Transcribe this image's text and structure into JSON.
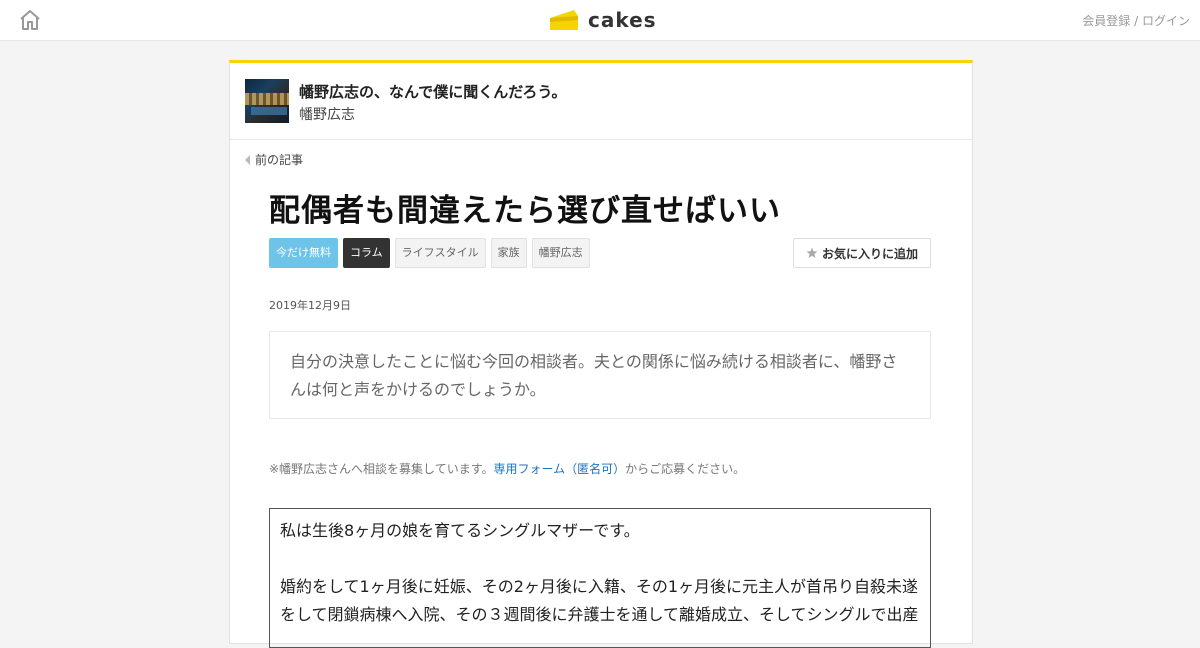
{
  "header": {
    "logo_text": "cakes",
    "register_label": "会員登録",
    "separator": " / ",
    "login_label": "ログイン",
    "accent_color": "#f5d400"
  },
  "series": {
    "title": "幡野広志の、なんで僕に聞くんだろう。",
    "author": "幡野広志"
  },
  "nav": {
    "prev_label": "前の記事"
  },
  "article": {
    "title": "配偶者も間違えたら選び直せばいい",
    "tags": [
      "今だけ無料",
      "コラム",
      "ライフスタイル",
      "家族",
      "幡野広志"
    ],
    "favorite_label": "お気に入りに追加",
    "date": "2019年12月9日",
    "lead": "自分の決意したことに悩む今回の相談者。夫との関係に悩み続ける相談者に、幡野さんは何と声をかけるのでしょうか。",
    "notice_prefix": "※幡野広志さんへ相談を募集しています。",
    "notice_link": "専用フォーム（匿名可）",
    "notice_suffix": "からご応募ください。",
    "letter": [
      "私は生後8ヶ月の娘を育てるシングルマザーです。",
      "婚約をして1ヶ月後に妊娠、その2ヶ月後に入籍、その1ヶ月後に元主人が首吊り自殺未遂をして閉鎖病棟へ入院、その３週間後に弁護士を通して離婚成立、そしてシングルで出産"
    ]
  },
  "icons": {
    "home": "home-icon",
    "prev": "chevron-left-icon",
    "star": "star-icon"
  }
}
